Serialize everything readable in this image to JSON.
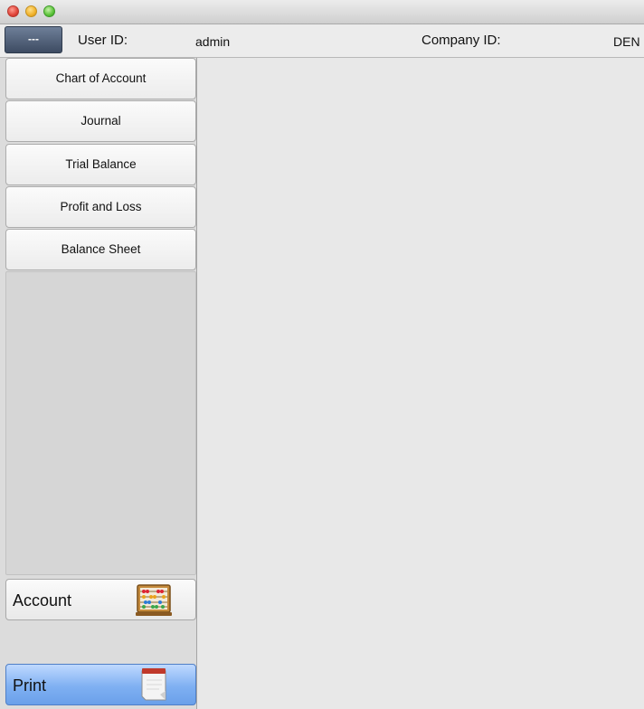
{
  "window": {
    "controls": [
      "close",
      "minimize",
      "zoom"
    ]
  },
  "header": {
    "menu_button_label": "---",
    "user_id_label": "User ID:",
    "user_id_value": "admin",
    "company_id_label": "Company ID:",
    "company_id_value": "DEN"
  },
  "sidebar": {
    "nav_items": [
      {
        "label": "Chart of Account"
      },
      {
        "label": "Journal"
      },
      {
        "label": "Trial Balance"
      },
      {
        "label": "Profit and Loss"
      },
      {
        "label": "Balance Sheet"
      }
    ],
    "account_button": {
      "label": "Account",
      "icon": "abacus-icon"
    },
    "print_button": {
      "label": "Print",
      "icon": "notepad-icon"
    }
  },
  "colors": {
    "accent_selected": "#7fb0f2",
    "close": "#e0443a",
    "minimize": "#f0b12a",
    "zoom": "#5ac238"
  }
}
